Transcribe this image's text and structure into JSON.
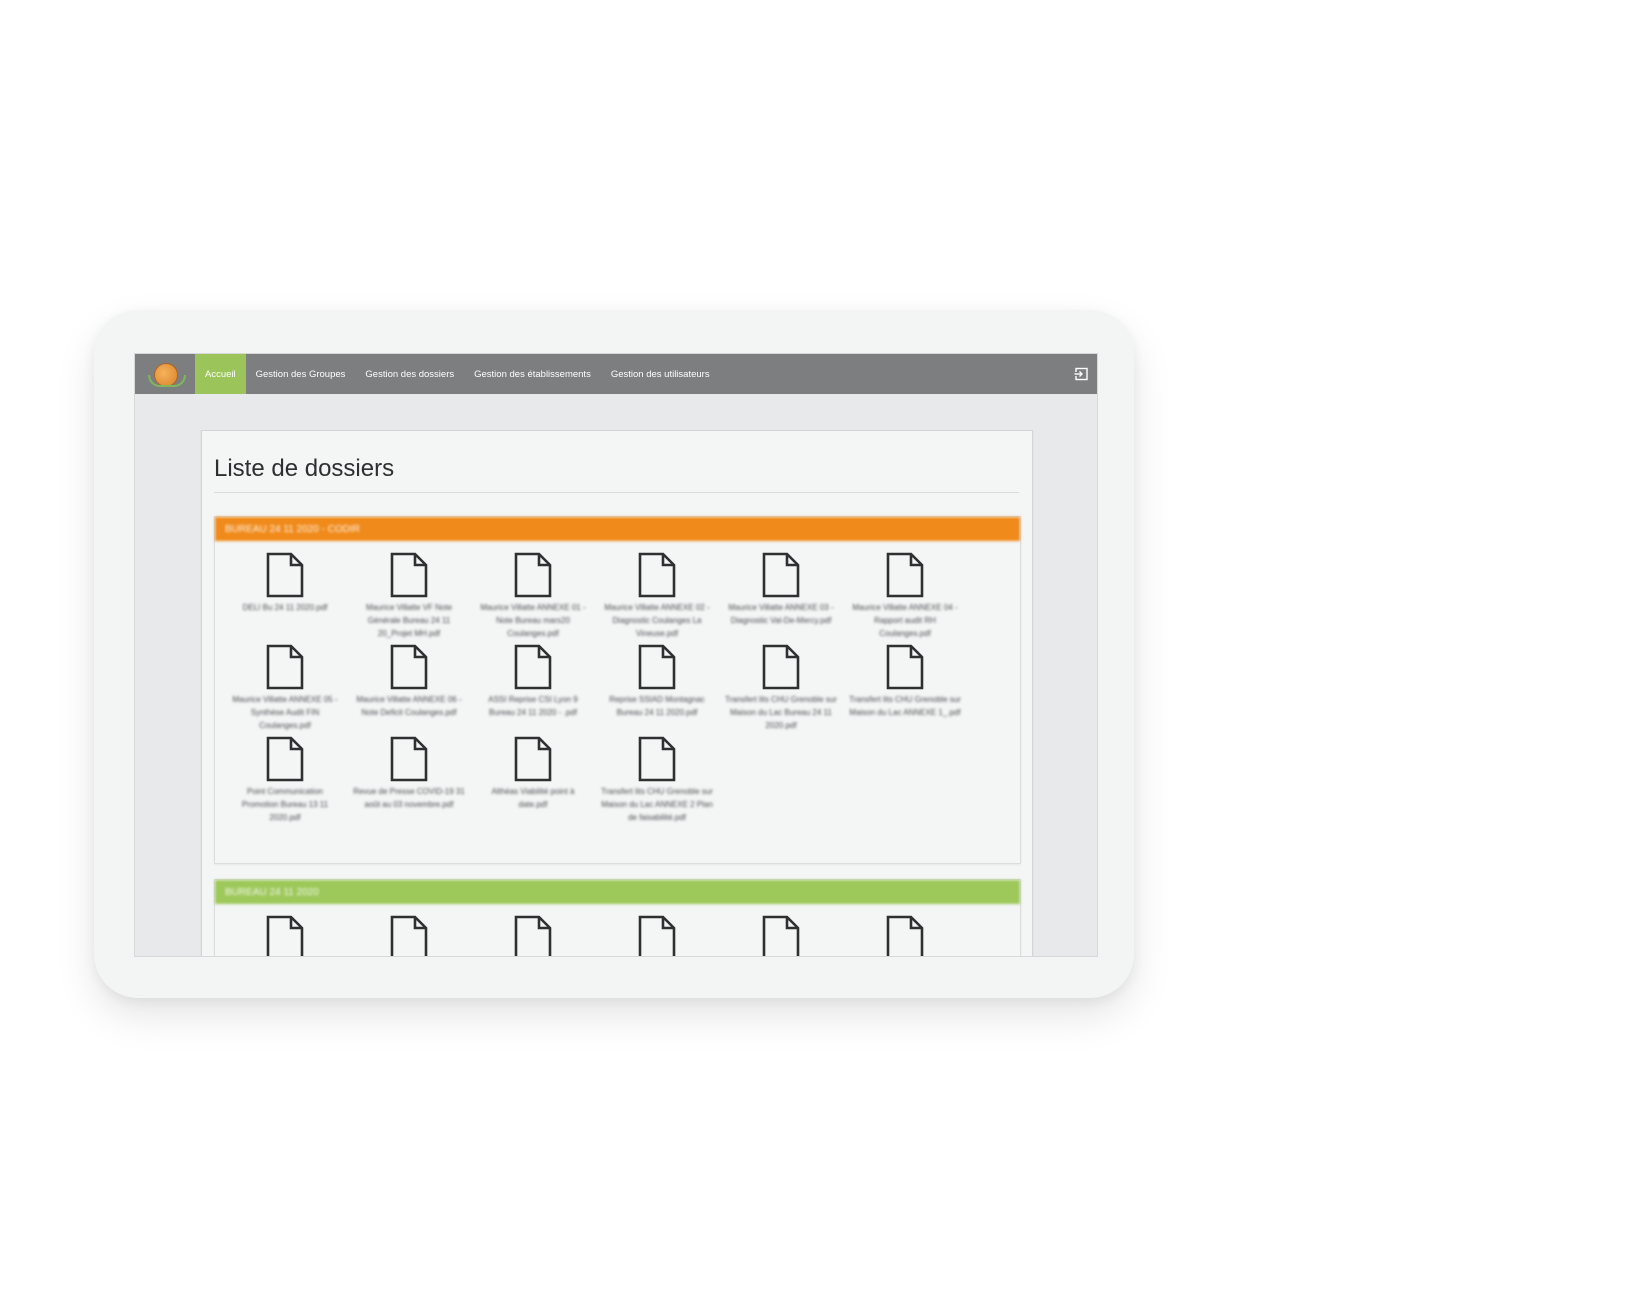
{
  "nav": {
    "items": [
      {
        "label": "Accueil",
        "active": true
      },
      {
        "label": "Gestion des Groupes",
        "active": false
      },
      {
        "label": "Gestion des dossiers",
        "active": false
      },
      {
        "label": "Gestion des établissements",
        "active": false
      },
      {
        "label": "Gestion des utilisateurs",
        "active": false
      }
    ],
    "logout_icon": "logout-icon"
  },
  "page": {
    "title": "Liste de dossiers"
  },
  "groups": [
    {
      "title": "BUREAU 24 11 2020 - CODIR",
      "color": "#f08a1a",
      "files": [
        "DELI Bu 24 11 2020.pdf",
        "Maurice Villatte VF Note Générale Bureau 24 11 20_Projet MH.pdf",
        "Maurice Villatte ANNEXE 01 - Note Bureau mars20 Coulanges.pdf",
        "Maurice Villatte ANNEXE 02 - Diagnostic Coulanges La Vineuse.pdf",
        "Maurice Villatte ANNEXE 03 - Diagnostic Val-De-Mercy.pdf",
        "Maurice Villatte ANNEXE 04 - Rapport audit RH Coulanges.pdf",
        "Maurice Villatte ANNEXE 05 - Synthèse Audit FIN Coulanges.pdf",
        "Maurice Villatte ANNEXE 06 - Note Deficit Coulanges.pdf",
        "ASSI Reprise CSI Lyon 9 Bureau 24 11 2020 - .pdf",
        "Reprise SSIAD Montagnac Bureau 24 11 2020.pdf",
        "Transfert lits CHU Grenoble sur Maison du Lac Bureau 24 11 2020.pdf",
        "Transfert lits CHU Grenoble sur Maison du Lac ANNEXE 1_.pdf",
        "Point Communication Promotion Bureau 13 11 2020.pdf",
        "Revue de Presse COVID-19 31 août au 03 novembre.pdf",
        "Althéas Viabilité point à date.pdf",
        "Transfert lits CHU Grenoble sur Maison du Lac ANNEXE 2 Plan de faisabilité.pdf"
      ]
    },
    {
      "title": "BUREAU 24 11 2020",
      "color": "#9dc85a",
      "files": [
        "",
        "",
        "",
        "",
        "",
        ""
      ]
    }
  ]
}
